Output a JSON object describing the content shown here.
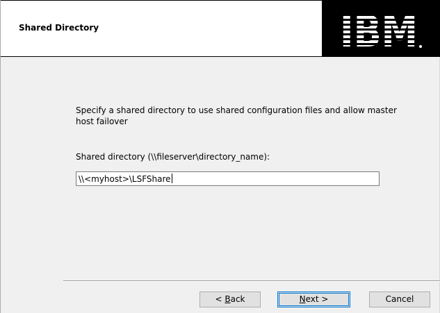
{
  "header": {
    "title": "Shared Directory",
    "logo_text": "IBM"
  },
  "main": {
    "description": "Specify a shared directory to use shared configuration files and allow master host failover",
    "field_label": "Shared directory (\\\\fileserver\\directory_name):",
    "field_value": "\\\\<myhost>\\LSFShare"
  },
  "buttons": {
    "back_prefix": "< ",
    "back_mnemonic": "B",
    "back_rest": "ack",
    "next_mnemonic": "N",
    "next_rest": "ext >",
    "cancel_label": "Cancel"
  },
  "colors": {
    "header_bg": "#ffffff",
    "logo_bg": "#000000",
    "body_bg": "#f0f0f0",
    "default_button_border": "#0078d7"
  }
}
